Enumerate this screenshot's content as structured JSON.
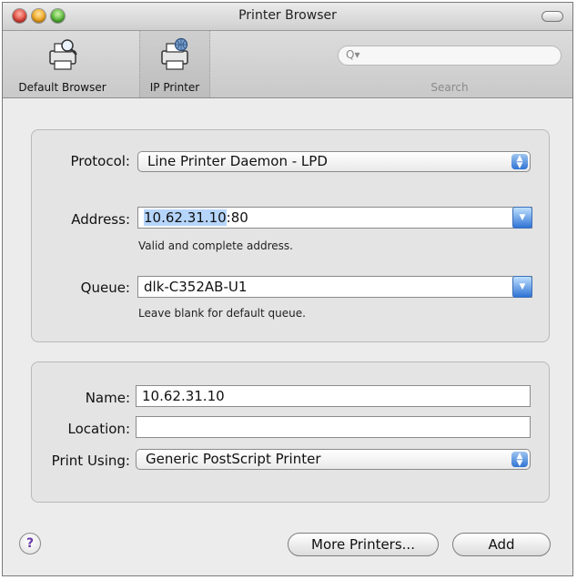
{
  "window": {
    "title": "Printer Browser"
  },
  "toolbar": {
    "default_label": "Default Browser",
    "ip_label": "IP Printer",
    "search_label": "Search",
    "search_placeholder": "Q▾"
  },
  "connection": {
    "protocol_label": "Protocol:",
    "protocol_value": "Line Printer Daemon - LPD",
    "address_label": "Address:",
    "address_selected": "10.62.31.10",
    "address_rest": ":80",
    "address_note": "Valid and complete address.",
    "queue_label": "Queue:",
    "queue_value": "dlk-C352AB-U1",
    "queue_note": "Leave blank for default queue."
  },
  "printer": {
    "name_label": "Name:",
    "name_value": "10.62.31.10",
    "location_label": "Location:",
    "location_value": "",
    "print_using_label": "Print Using:",
    "print_using_value": "Generic PostScript Printer"
  },
  "footer": {
    "help_label": "?",
    "more_label": "More Printers...",
    "add_label": "Add"
  }
}
